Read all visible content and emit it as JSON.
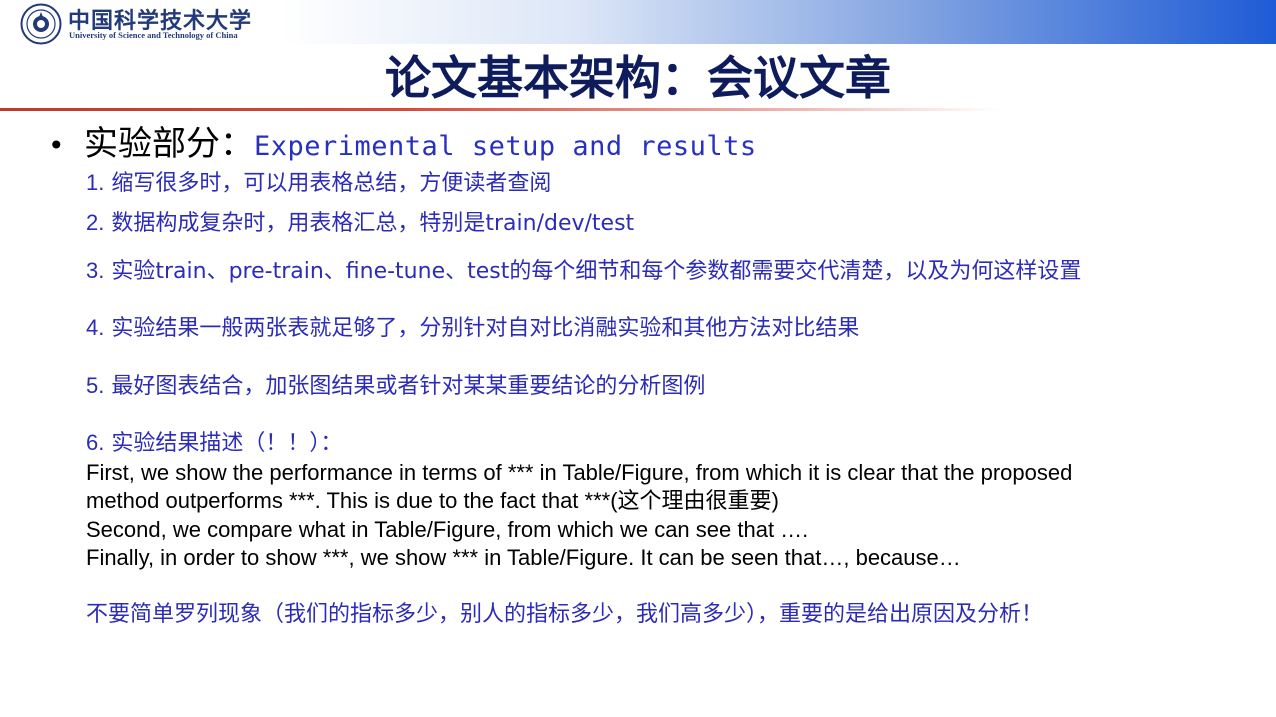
{
  "header": {
    "logo_cn": "中国科学技术大学",
    "logo_en": "University of Science and Technology of China",
    "band_color": "#1e5bd6"
  },
  "title": "论文基本架构：会议文章",
  "section": {
    "bullet": "•",
    "heading_cn": "实验部分：",
    "heading_en": "Experimental setup and results"
  },
  "items": [
    {
      "num": "1.",
      "text": "缩写很多时，可以用表格总结，方便读者查阅"
    },
    {
      "num": "2.",
      "text": "数据构成复杂时，用表格汇总，特别是train/dev/test"
    },
    {
      "num": "3.",
      "text": "实验train、pre-train、fine-tune、test的每个细节和每个参数都需要交代清楚，以及为何这样设置"
    },
    {
      "num": "4.",
      "text": "实验结果一般两张表就足够了，分别针对自对比消融实验和其他方法对比结果"
    },
    {
      "num": "5.",
      "text": "最好图表结合，加张图结果或者针对某某重要结论的分析图例"
    },
    {
      "num": "6.",
      "text": "实验结果描述（！！）："
    }
  ],
  "description": {
    "line1": "   First, we show the performance in terms of *** in Table/Figure, from which it is clear that  the proposed",
    "line2a": "method outperforms ***. This is due to the fact that ***(",
    "line2b": "这个理由很重要",
    "line2c": ")",
    "line3": "Second, we compare what in Table/Figure, from which we can see that ….",
    "line4": "Finally, in order to show ***, we show *** in Table/Figure. It can be seen that…, because…"
  },
  "note": "不要简单罗列现象（我们的指标多少，别人的指标多少，我们高多少），重要的是给出原因及分析！",
  "colors": {
    "title": "#0f1c5c",
    "accent_blue": "#2c2cb8",
    "rule_red": "#c0392b"
  }
}
